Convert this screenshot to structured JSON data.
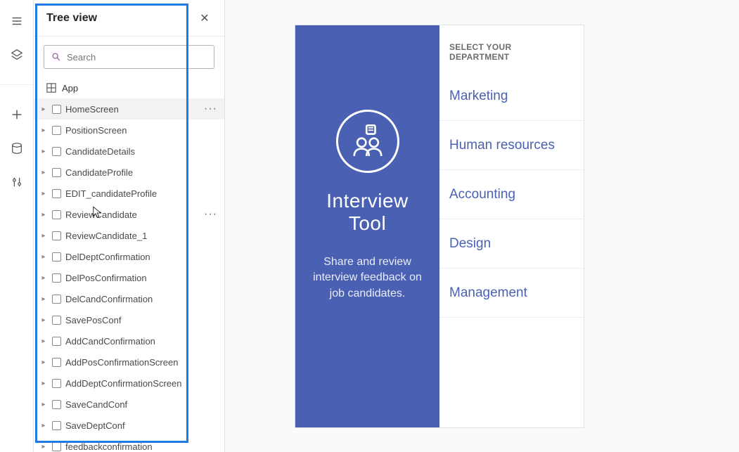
{
  "leftrail": {
    "icons": [
      "hamburger-icon",
      "layers-icon",
      "plus-icon",
      "data-icon",
      "settings-icon"
    ]
  },
  "tree": {
    "title": "Tree view",
    "search_placeholder": "Search",
    "app_label": "App",
    "items": [
      {
        "label": "HomeScreen",
        "selected": true,
        "more": true
      },
      {
        "label": "PositionScreen"
      },
      {
        "label": "CandidateDetails"
      },
      {
        "label": "CandidateProfile"
      },
      {
        "label": "EDIT_candidateProfile"
      },
      {
        "label": "ReviewCandidate",
        "more": true,
        "hover": true
      },
      {
        "label": "ReviewCandidate_1"
      },
      {
        "label": "DelDeptConfirmation"
      },
      {
        "label": "DelPosConfirmation"
      },
      {
        "label": "DelCandConfirmation"
      },
      {
        "label": "SavePosConf"
      },
      {
        "label": "AddCandConfirmation"
      },
      {
        "label": "AddPosConfirmationScreen"
      },
      {
        "label": "AddDeptConfirmationScreen"
      },
      {
        "label": "SaveCandConf"
      },
      {
        "label": "SaveDeptConf"
      },
      {
        "label": "feedbackconfirmation"
      }
    ]
  },
  "preview": {
    "hero_title": "Interview Tool",
    "hero_sub": "Share and review interview feedback on job candidates.",
    "dept_header": "SELECT YOUR DEPARTMENT",
    "departments": [
      "Marketing",
      "Human resources",
      "Accounting",
      "Design",
      "Management"
    ]
  }
}
